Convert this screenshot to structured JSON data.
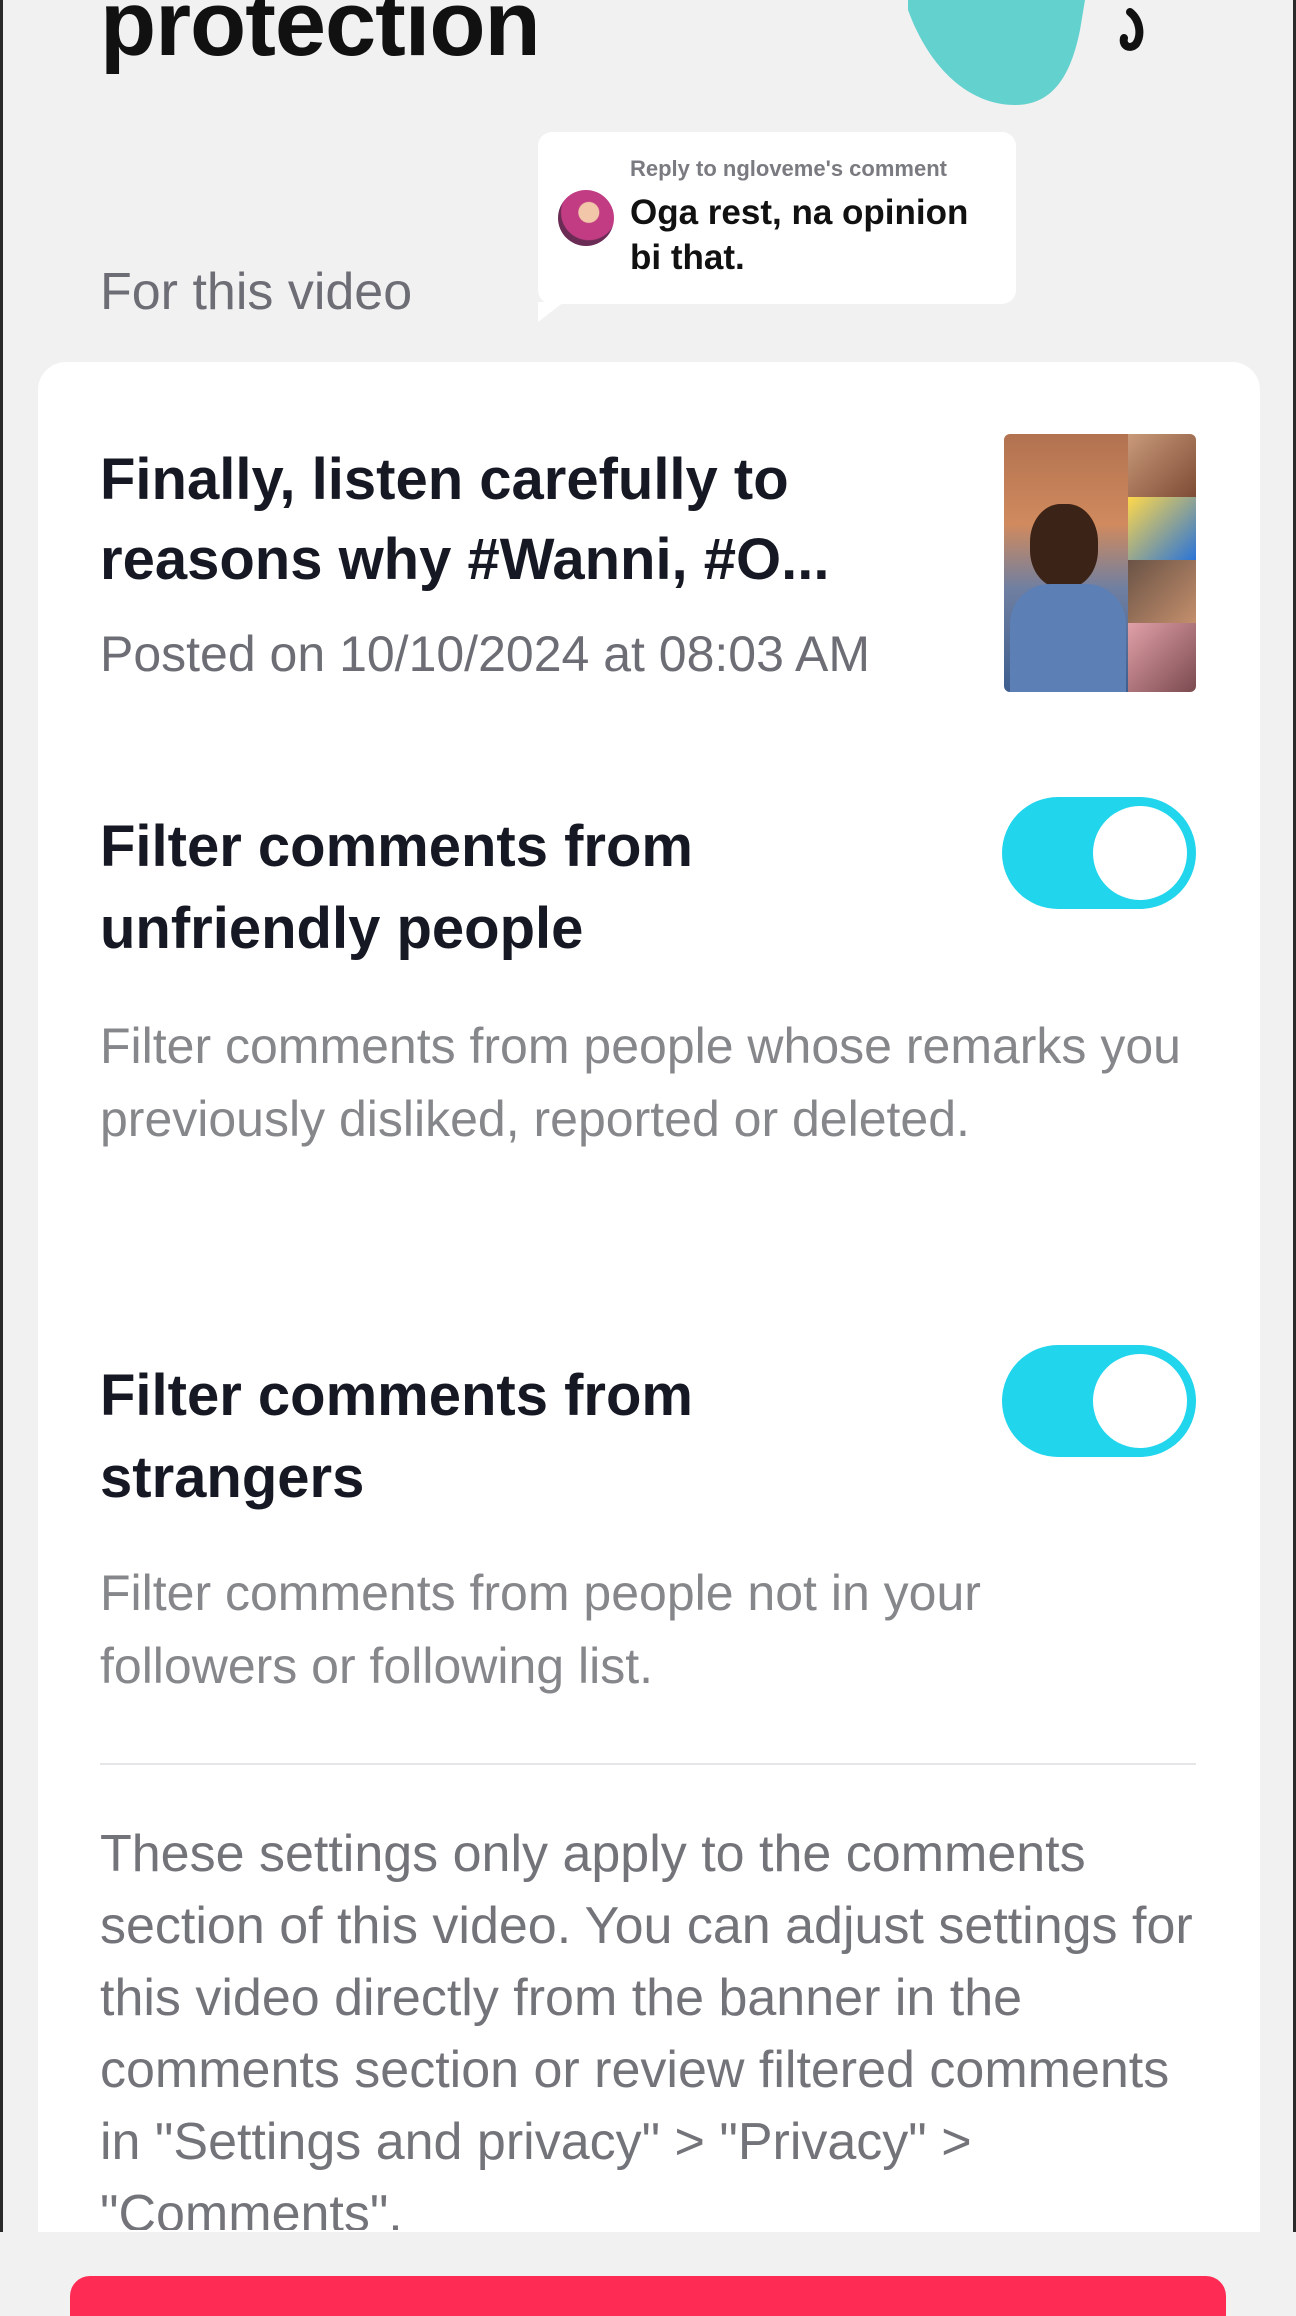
{
  "header": {
    "title": "protection"
  },
  "reply": {
    "heading": "Reply to ngloveme's comment",
    "text": "Oga rest, na opinion bi that."
  },
  "section": {
    "label": "For this video"
  },
  "video": {
    "title": "Finally, listen carefully to reasons why #Wanni, #O...",
    "posted": "Posted on 10/10/2024 at 08:03 AM"
  },
  "settings": [
    {
      "title": "Filter comments from unfriendly people",
      "description": "Filter comments from people whose remarks you previously disliked, reported or deleted.",
      "enabled": true
    },
    {
      "title": "Filter comments from strangers",
      "description": "Filter comments from people not in your followers or following list.",
      "enabled": true
    }
  ],
  "footnote": "These settings only apply to the comments section of this video. You can adjust settings for this video directly from the banner in the comments section or review filtered comments in \"Settings and privacy\" > \"Privacy\" > \"Comments\".",
  "colors": {
    "toggle_on": "#20d5ec",
    "primary_button": "#fe2c55",
    "hero_shape": "#63d1cd"
  }
}
